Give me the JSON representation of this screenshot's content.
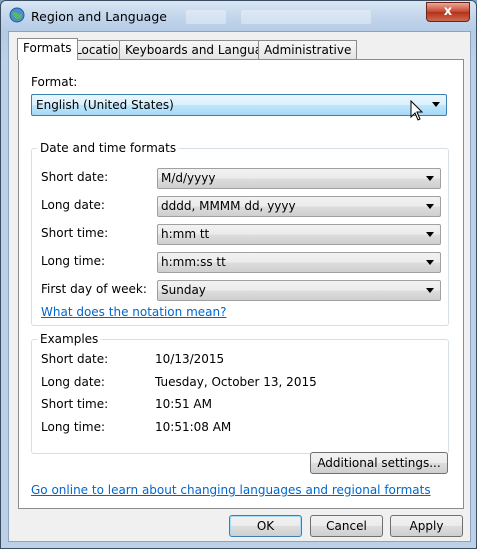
{
  "window": {
    "title": "Region and Language",
    "close_label": "x"
  },
  "tabs": [
    "Formats",
    "Location",
    "Keyboards and Languages",
    "Administrative"
  ],
  "format": {
    "label": "Format:",
    "value": "English (United States)"
  },
  "date_time": {
    "title": "Date and time formats",
    "rows": [
      {
        "label": "Short date:",
        "value": "M/d/yyyy"
      },
      {
        "label": "Long date:",
        "value": "dddd, MMMM dd, yyyy"
      },
      {
        "label": "Short time:",
        "value": "h:mm tt"
      },
      {
        "label": "Long time:",
        "value": "h:mm:ss tt"
      },
      {
        "label": "First day of week:",
        "value": "Sunday"
      }
    ],
    "notation_link": "What does the notation mean?"
  },
  "examples": {
    "title": "Examples",
    "rows": [
      {
        "label": "Short date:",
        "value": "10/13/2015"
      },
      {
        "label": "Long date:",
        "value": "Tuesday, October 13, 2015"
      },
      {
        "label": "Short time:",
        "value": "10:51 AM"
      },
      {
        "label": "Long time:",
        "value": "10:51:08 AM"
      }
    ]
  },
  "additional_settings": "Additional settings...",
  "online_link": "Go online to learn about changing languages and regional formats",
  "buttons": {
    "ok": "OK",
    "cancel": "Cancel",
    "apply": "Apply"
  },
  "colors": {
    "link": "#0066cc",
    "accent": "#3c7fb1",
    "close": "#c7432b"
  }
}
